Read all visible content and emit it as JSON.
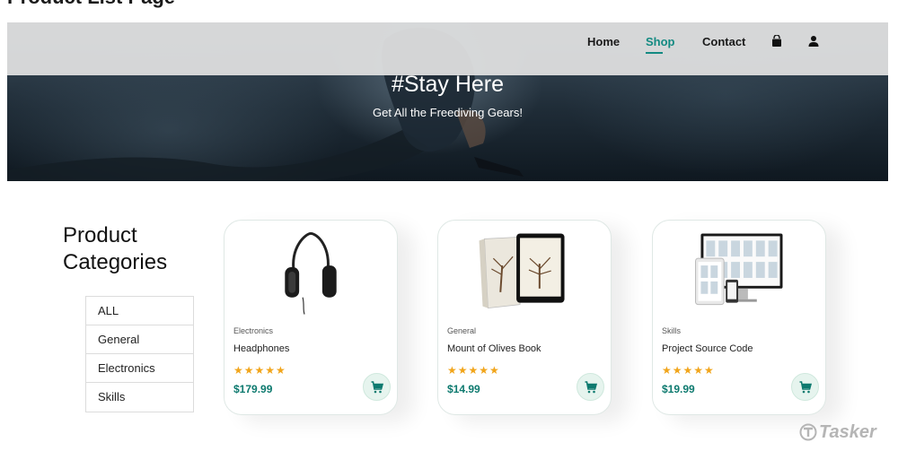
{
  "page": {
    "heading": "Product List Page"
  },
  "nav": {
    "items": [
      {
        "label": "Home",
        "active": false
      },
      {
        "label": "Shop",
        "active": true
      },
      {
        "label": "Contact",
        "active": false
      }
    ],
    "icons": [
      "shopping-bag-icon",
      "user-icon"
    ],
    "active_color": "#138a82"
  },
  "hero": {
    "title": "#Stay Here",
    "subtitle": "Get All the Freediving Gears!"
  },
  "categories": {
    "title_line1": "Product",
    "title_line2": "Categories",
    "items": [
      "ALL",
      "General",
      "Electronics",
      "Skills"
    ]
  },
  "products": [
    {
      "category": "Electronics",
      "name": "Headphones",
      "rating": 5,
      "stars": "★★★★★",
      "price": "$179.99",
      "image": "headphones"
    },
    {
      "category": "General",
      "name": "Mount of Olives Book",
      "rating": 5,
      "stars": "★★★★★",
      "price": "$14.99",
      "image": "book"
    },
    {
      "category": "Skills",
      "name": "Project Source Code",
      "rating": 5,
      "stars": "★★★★★",
      "price": "$19.99",
      "image": "devices"
    }
  ],
  "colors": {
    "price": "#0e7a6f",
    "star": "#f1a51b",
    "cart_bg": "#e6f4ee"
  },
  "watermark": {
    "brand": "Tasker"
  }
}
